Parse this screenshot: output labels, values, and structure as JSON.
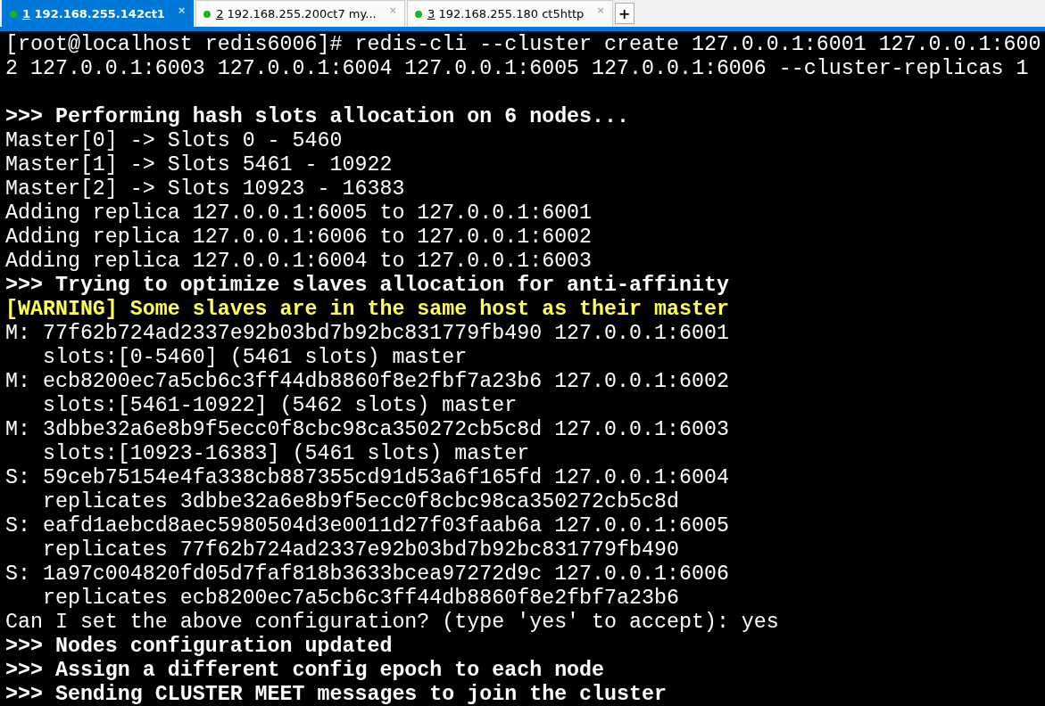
{
  "tabs": [
    {
      "number": "1",
      "label": " 192.168.255.142ct1",
      "close": "×",
      "selected": true
    },
    {
      "number": "2",
      "label": " 192.168.255.200ct7 my...",
      "close": "×",
      "selected": false
    },
    {
      "number": "3",
      "label": " 192.168.255.180 ct5http",
      "close": "×",
      "selected": false
    }
  ],
  "new_tab": "+",
  "terminal": {
    "lines": [
      {
        "kind": "plain",
        "text": "[root@localhost redis6006]# redis-cli --cluster create 127.0.0.1:6001 127.0.0.1:600"
      },
      {
        "kind": "plain",
        "text": "2 127.0.0.1:6003 127.0.0.1:6004 127.0.0.1:6005 127.0.0.1:6006 --cluster-replicas 1"
      },
      {
        "kind": "blank"
      },
      {
        "kind": "bold",
        "text": ">>> Performing hash slots allocation on 6 nodes..."
      },
      {
        "kind": "plain",
        "text": "Master[0] -> Slots 0 - 5460"
      },
      {
        "kind": "plain",
        "text": "Master[1] -> Slots 5461 - 10922"
      },
      {
        "kind": "plain",
        "text": "Master[2] -> Slots 10923 - 16383"
      },
      {
        "kind": "plain",
        "text": "Adding replica 127.0.0.1:6005 to 127.0.0.1:6001"
      },
      {
        "kind": "plain",
        "text": "Adding replica 127.0.0.1:6006 to 127.0.0.1:6002"
      },
      {
        "kind": "plain",
        "text": "Adding replica 127.0.0.1:6004 to 127.0.0.1:6003"
      },
      {
        "kind": "bold",
        "text": ">>> Trying to optimize slaves allocation for anti-affinity"
      },
      {
        "kind": "warning",
        "text": "[WARNING] Some slaves are in the same host as their master"
      },
      {
        "kind": "plain",
        "text": "M: 77f62b724ad2337e92b03bd7b92bc831779fb490 127.0.0.1:6001"
      },
      {
        "kind": "plain",
        "text": "   slots:[0-5460] (5461 slots) master"
      },
      {
        "kind": "plain",
        "text": "M: ecb8200ec7a5cb6c3ff44db8860f8e2fbf7a23b6 127.0.0.1:6002"
      },
      {
        "kind": "plain",
        "text": "   slots:[5461-10922] (5462 slots) master"
      },
      {
        "kind": "plain",
        "text": "M: 3dbbe32a6e8b9f5ecc0f8cbc98ca350272cb5c8d 127.0.0.1:6003"
      },
      {
        "kind": "plain",
        "text": "   slots:[10923-16383] (5461 slots) master"
      },
      {
        "kind": "plain",
        "text": "S: 59ceb75154e4fa338cb887355cd91d53a6f165fd 127.0.0.1:6004"
      },
      {
        "kind": "plain",
        "text": "   replicates 3dbbe32a6e8b9f5ecc0f8cbc98ca350272cb5c8d"
      },
      {
        "kind": "plain",
        "text": "S: eafd1aebcd8aec5980504d3e0011d27f03faab6a 127.0.0.1:6005"
      },
      {
        "kind": "plain",
        "text": "   replicates 77f62b724ad2337e92b03bd7b92bc831779fb490"
      },
      {
        "kind": "plain",
        "text": "S: 1a97c004820fd05d7faf818b3633bcea97272d9c 127.0.0.1:6006"
      },
      {
        "kind": "plain",
        "text": "   replicates ecb8200ec7a5cb6c3ff44db8860f8e2fbf7a23b6"
      },
      {
        "kind": "plain",
        "text": "Can I set the above configuration? (type 'yes' to accept): yes"
      },
      {
        "kind": "bold",
        "text": ">>> Nodes configuration updated"
      },
      {
        "kind": "bold",
        "text": ">>> Assign a different config epoch to each node"
      },
      {
        "kind": "bold",
        "text": ">>> Sending CLUSTER MEET messages to join the cluster"
      }
    ]
  }
}
